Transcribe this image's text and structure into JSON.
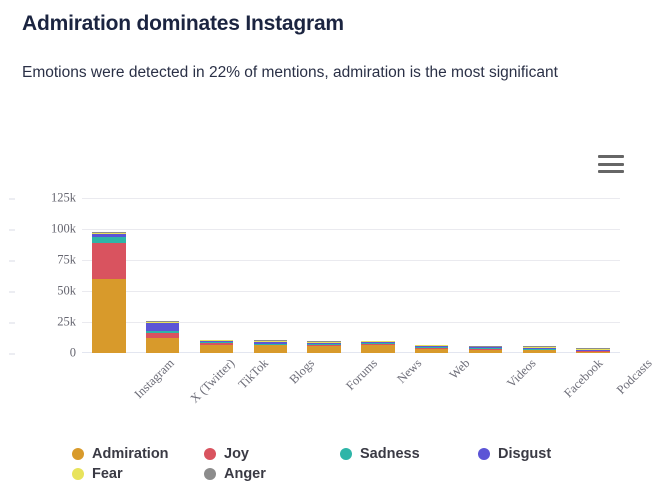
{
  "header": {
    "title": "Admiration dominates Instagram",
    "subtitle": "Emotions were detected in 22% of mentions, admiration is the most significant"
  },
  "toolbar": {
    "menu_label": "Chart context menu",
    "menu_icon": "hamburger-menu-icon"
  },
  "chart_data": {
    "type": "bar",
    "stacked": true,
    "title": "Admiration dominates Instagram",
    "subtitle": "Emotions were detected in 22% of mentions, admiration is the most significant",
    "xlabel": "",
    "ylabel": "",
    "ylim": [
      0,
      125000
    ],
    "yticks": [
      0,
      25000,
      50000,
      75000,
      100000,
      125000
    ],
    "ytick_labels": [
      "0",
      "25k",
      "50k",
      "75k",
      "100k",
      "125k"
    ],
    "grid": true,
    "legend_position": "bottom",
    "categories": [
      "Instagram",
      "X (Twitter)",
      "TikTok",
      "Blogs",
      "Forums",
      "News",
      "Web",
      "Videos",
      "Facebook",
      "Podcasts"
    ],
    "series": [
      {
        "name": "Admiration",
        "color": "#d89a2b",
        "values": [
          60000,
          12000,
          6500,
          6200,
          5600,
          6800,
          3600,
          2600,
          2100,
          500
        ]
      },
      {
        "name": "Joy",
        "color": "#d9535f",
        "values": [
          29000,
          4500,
          1700,
          400,
          350,
          300,
          250,
          150,
          120,
          60
        ]
      },
      {
        "name": "Sadness",
        "color": "#2eb5a8",
        "values": [
          4200,
          1500,
          300,
          200,
          150,
          120,
          100,
          80,
          60,
          30
        ]
      },
      {
        "name": "Disgust",
        "color": "#5c55d6",
        "values": [
          2800,
          6500,
          300,
          1500,
          1200,
          250,
          150,
          120,
          90,
          40
        ]
      },
      {
        "name": "Fear",
        "color": "#e8e35c",
        "values": [
          700,
          400,
          120,
          100,
          80,
          60,
          50,
          40,
          30,
          10
        ]
      },
      {
        "name": "Anger",
        "color": "#8c8c8c",
        "values": [
          600,
          350,
          100,
          90,
          70,
          50,
          40,
          30,
          25,
          10
        ]
      }
    ]
  },
  "legend": {
    "items": [
      {
        "label": "Admiration",
        "color": "#d89a2b"
      },
      {
        "label": "Joy",
        "color": "#d9535f"
      },
      {
        "label": "Sadness",
        "color": "#2eb5a8"
      },
      {
        "label": "Disgust",
        "color": "#5c55d6"
      },
      {
        "label": "Fear",
        "color": "#e8e35c"
      },
      {
        "label": "Anger",
        "color": "#8c8c8c"
      }
    ]
  }
}
